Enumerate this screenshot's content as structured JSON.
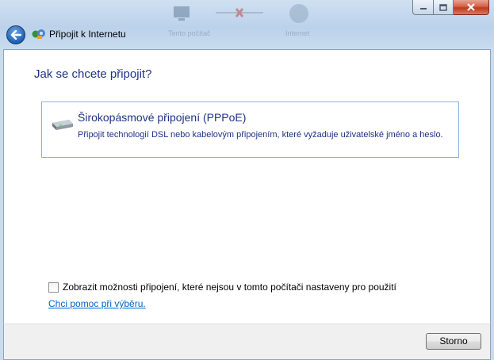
{
  "window": {
    "background_labels": [
      "Tento počítač",
      "Internet"
    ]
  },
  "nav": {
    "title": "Připojit k Internetu"
  },
  "main": {
    "heading": "Jak se chcete připojit?",
    "option": {
      "title": "Širokopásmové připojení (PPPoE)",
      "description": "Připojit technologií DSL nebo kabelovým připojením, které vyžaduje uživatelské jméno a heslo."
    },
    "show_options_checkbox": {
      "label": "Zobrazit možnosti připojení, které nejsou v tomto počítači nastaveny pro použití",
      "checked": false
    },
    "help_link": "Chci pomoc při výběru."
  },
  "footer": {
    "cancel_label": "Storno"
  },
  "colors": {
    "heading": "#1e3287",
    "link": "#0066cc",
    "close_button": "#c2371f"
  },
  "icons": [
    "back-arrow-icon",
    "network-connection-icon",
    "broadband-modem-icon",
    "minimize-icon",
    "maximize-icon",
    "close-icon"
  ]
}
